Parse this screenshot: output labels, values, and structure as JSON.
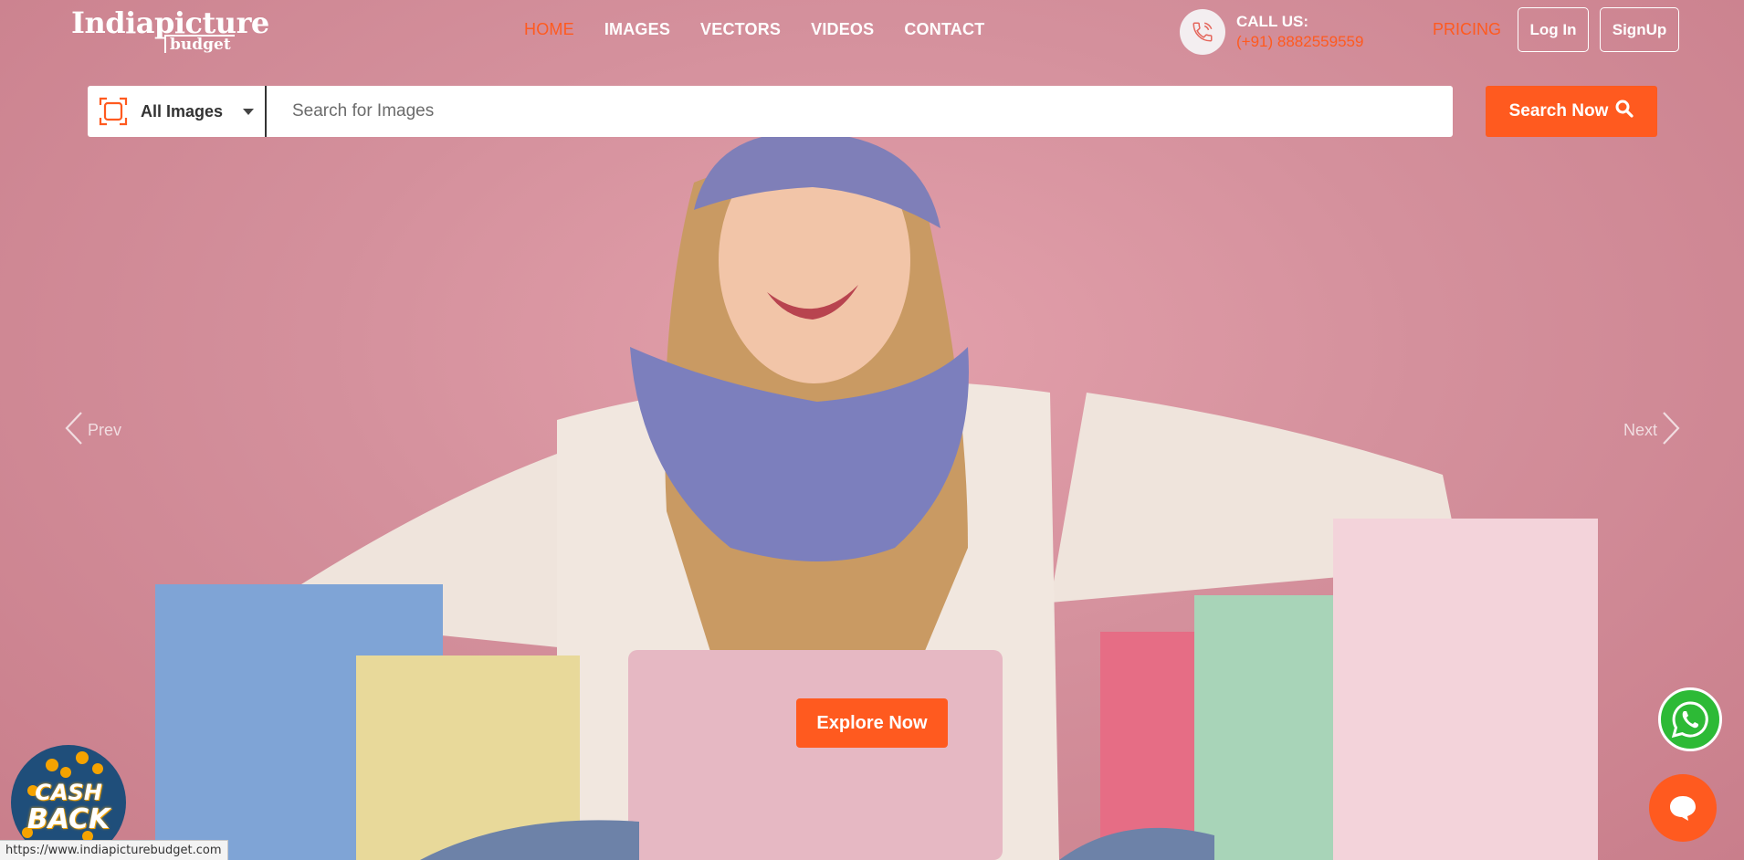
{
  "brand": {
    "logo_main": "Indiapicture",
    "logo_sub": "budget"
  },
  "nav": {
    "items": [
      {
        "label": "HOME",
        "active": true
      },
      {
        "label": "IMAGES",
        "active": false
      },
      {
        "label": "VECTORS",
        "active": false
      },
      {
        "label": "VIDEOS",
        "active": false
      },
      {
        "label": "CONTACT",
        "active": false
      }
    ]
  },
  "contact": {
    "label": "CALL US:",
    "phone": "(+91) 8882559559",
    "icon": "phone-icon"
  },
  "header_actions": {
    "pricing": "PRICING",
    "login": "Log In",
    "signup": "SignUp"
  },
  "search": {
    "category": "All Images",
    "category_icon": "image-frame-icon",
    "placeholder": "Search for Images",
    "value": "",
    "button_label": "Search Now",
    "button_icon": "search-icon"
  },
  "slider": {
    "prev_label": "Prev",
    "next_label": "Next",
    "cta_label": "Explore Now"
  },
  "widgets": {
    "whatsapp_icon": "whatsapp-icon",
    "chat_icon": "chat-bubble-icon",
    "cashback_line1": "CASH",
    "cashback_line2": "BACK"
  },
  "status_url": "https://www.indiapicturebudget.com",
  "colors": {
    "accent": "#ff5a1f",
    "background": "#d48a97",
    "whatsapp": "#2dba36",
    "text_light": "#ffffff"
  }
}
